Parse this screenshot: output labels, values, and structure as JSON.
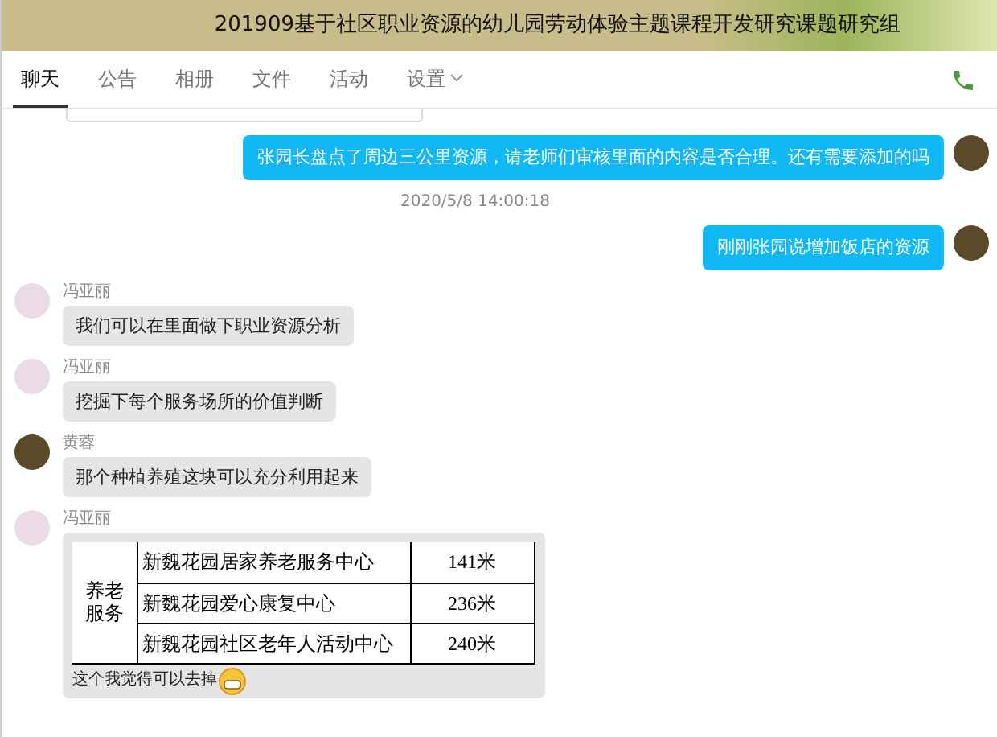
{
  "window": {
    "title": "201909基于社区职业资源的幼儿园劳动体验主题课程开发研究课题研究组"
  },
  "tabs": [
    {
      "label": "聊天",
      "selected": true,
      "kind": "plain"
    },
    {
      "label": "公告",
      "selected": false,
      "kind": "plain"
    },
    {
      "label": "相册",
      "selected": false,
      "kind": "plain"
    },
    {
      "label": "文件",
      "selected": false,
      "kind": "plain"
    },
    {
      "label": "活动",
      "selected": false,
      "kind": "plain"
    },
    {
      "label": "设置",
      "selected": false,
      "kind": "dropdown"
    }
  ],
  "messages": [
    {
      "kind": "outgoing",
      "text": "张园长盘点了周边三公里资源，请老师们审核里面的内容是否合理。还有需要添加的吗"
    },
    {
      "kind": "timestamp",
      "text": "2020/5/8 14:00:18"
    },
    {
      "kind": "outgoing",
      "text": "刚刚张园说增加饭店的资源"
    },
    {
      "kind": "incoming",
      "sender": "冯亚丽",
      "text": "我们可以在里面做下职业资源分析"
    },
    {
      "kind": "incoming",
      "sender": "冯亚丽",
      "text": "挖掘下每个服务场所的价值判断"
    },
    {
      "kind": "incoming",
      "sender": "黄蓉",
      "text": "那个种植养殖这块可以充分利用起来"
    },
    {
      "kind": "table",
      "sender": "冯亚丽",
      "group": "养老服务",
      "rows": [
        {
          "name": "新魏花园居家养老服务中心",
          "distance": "141米"
        },
        {
          "name": "新魏花园爱心康复中心",
          "distance": "236米"
        },
        {
          "name": "新魏花园社区老年人活动中心",
          "distance": "240米"
        }
      ],
      "caption": "这个我觉得可以去掉"
    }
  ]
}
